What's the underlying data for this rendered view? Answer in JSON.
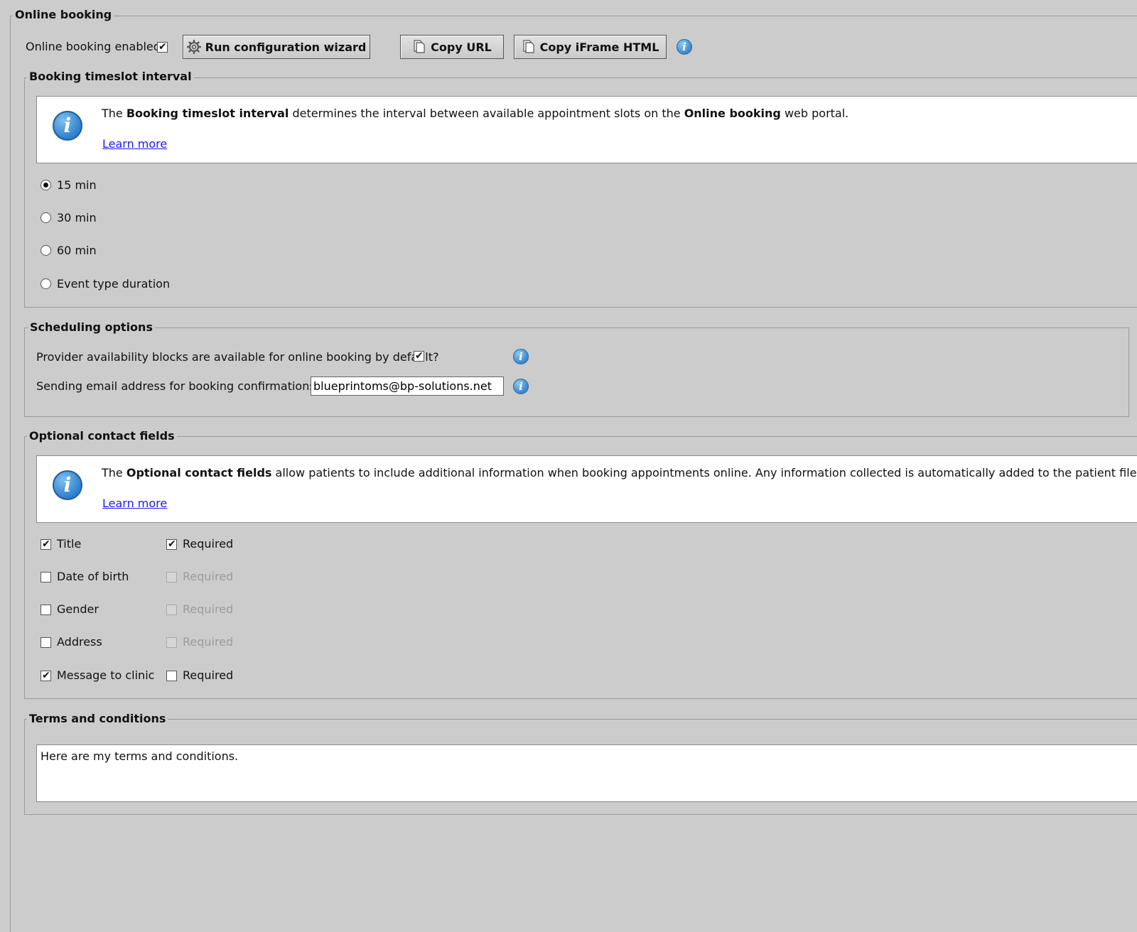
{
  "online_booking": {
    "legend": "Online booking",
    "enabled_label": "Online booking enabled",
    "enabled": true,
    "wizard_button": "Run configuration wizard",
    "copy_url_button": "Copy URL",
    "copy_iframe_button": "Copy iFrame HTML"
  },
  "timeslot": {
    "legend": "Booking timeslot interval",
    "info_pre": "The ",
    "info_bold1": "Booking timeslot interval",
    "info_mid": " determines the interval between available appointment slots on the ",
    "info_bold2": "Online booking",
    "info_post": " web portal.",
    "learn_more": "Learn more",
    "options": [
      "15 min",
      "30 min",
      "60 min",
      "Event type duration"
    ],
    "selected": "15 min"
  },
  "scheduling": {
    "legend": "Scheduling options",
    "availability_label": "Provider availability blocks are available for online booking by default?",
    "availability_checked": true,
    "email_label": "Sending email address for booking confirmations *",
    "email_value": "blueprintoms@bp-solutions.net"
  },
  "contact_fields": {
    "legend": "Optional contact fields",
    "info_pre": "The ",
    "info_bold": "Optional contact fields",
    "info_post": " allow patients to include additional information when booking appointments online. Any information collected is automatically added to the patient file.",
    "learn_more": "Learn more",
    "required_label": "Required",
    "fields": [
      {
        "label": "Title",
        "checked": true,
        "required": true,
        "required_enabled": true
      },
      {
        "label": "Date of birth",
        "checked": false,
        "required": false,
        "required_enabled": false
      },
      {
        "label": "Gender",
        "checked": false,
        "required": false,
        "required_enabled": false
      },
      {
        "label": "Address",
        "checked": false,
        "required": false,
        "required_enabled": false
      },
      {
        "label": "Message to clinic",
        "checked": true,
        "required": false,
        "required_enabled": true
      }
    ]
  },
  "terms": {
    "legend": "Terms and conditions",
    "text": "Here are my terms and conditions."
  },
  "colors": {
    "background": "#cccccc",
    "info_icon": "#3a86cf",
    "link": "#1a1aee"
  }
}
